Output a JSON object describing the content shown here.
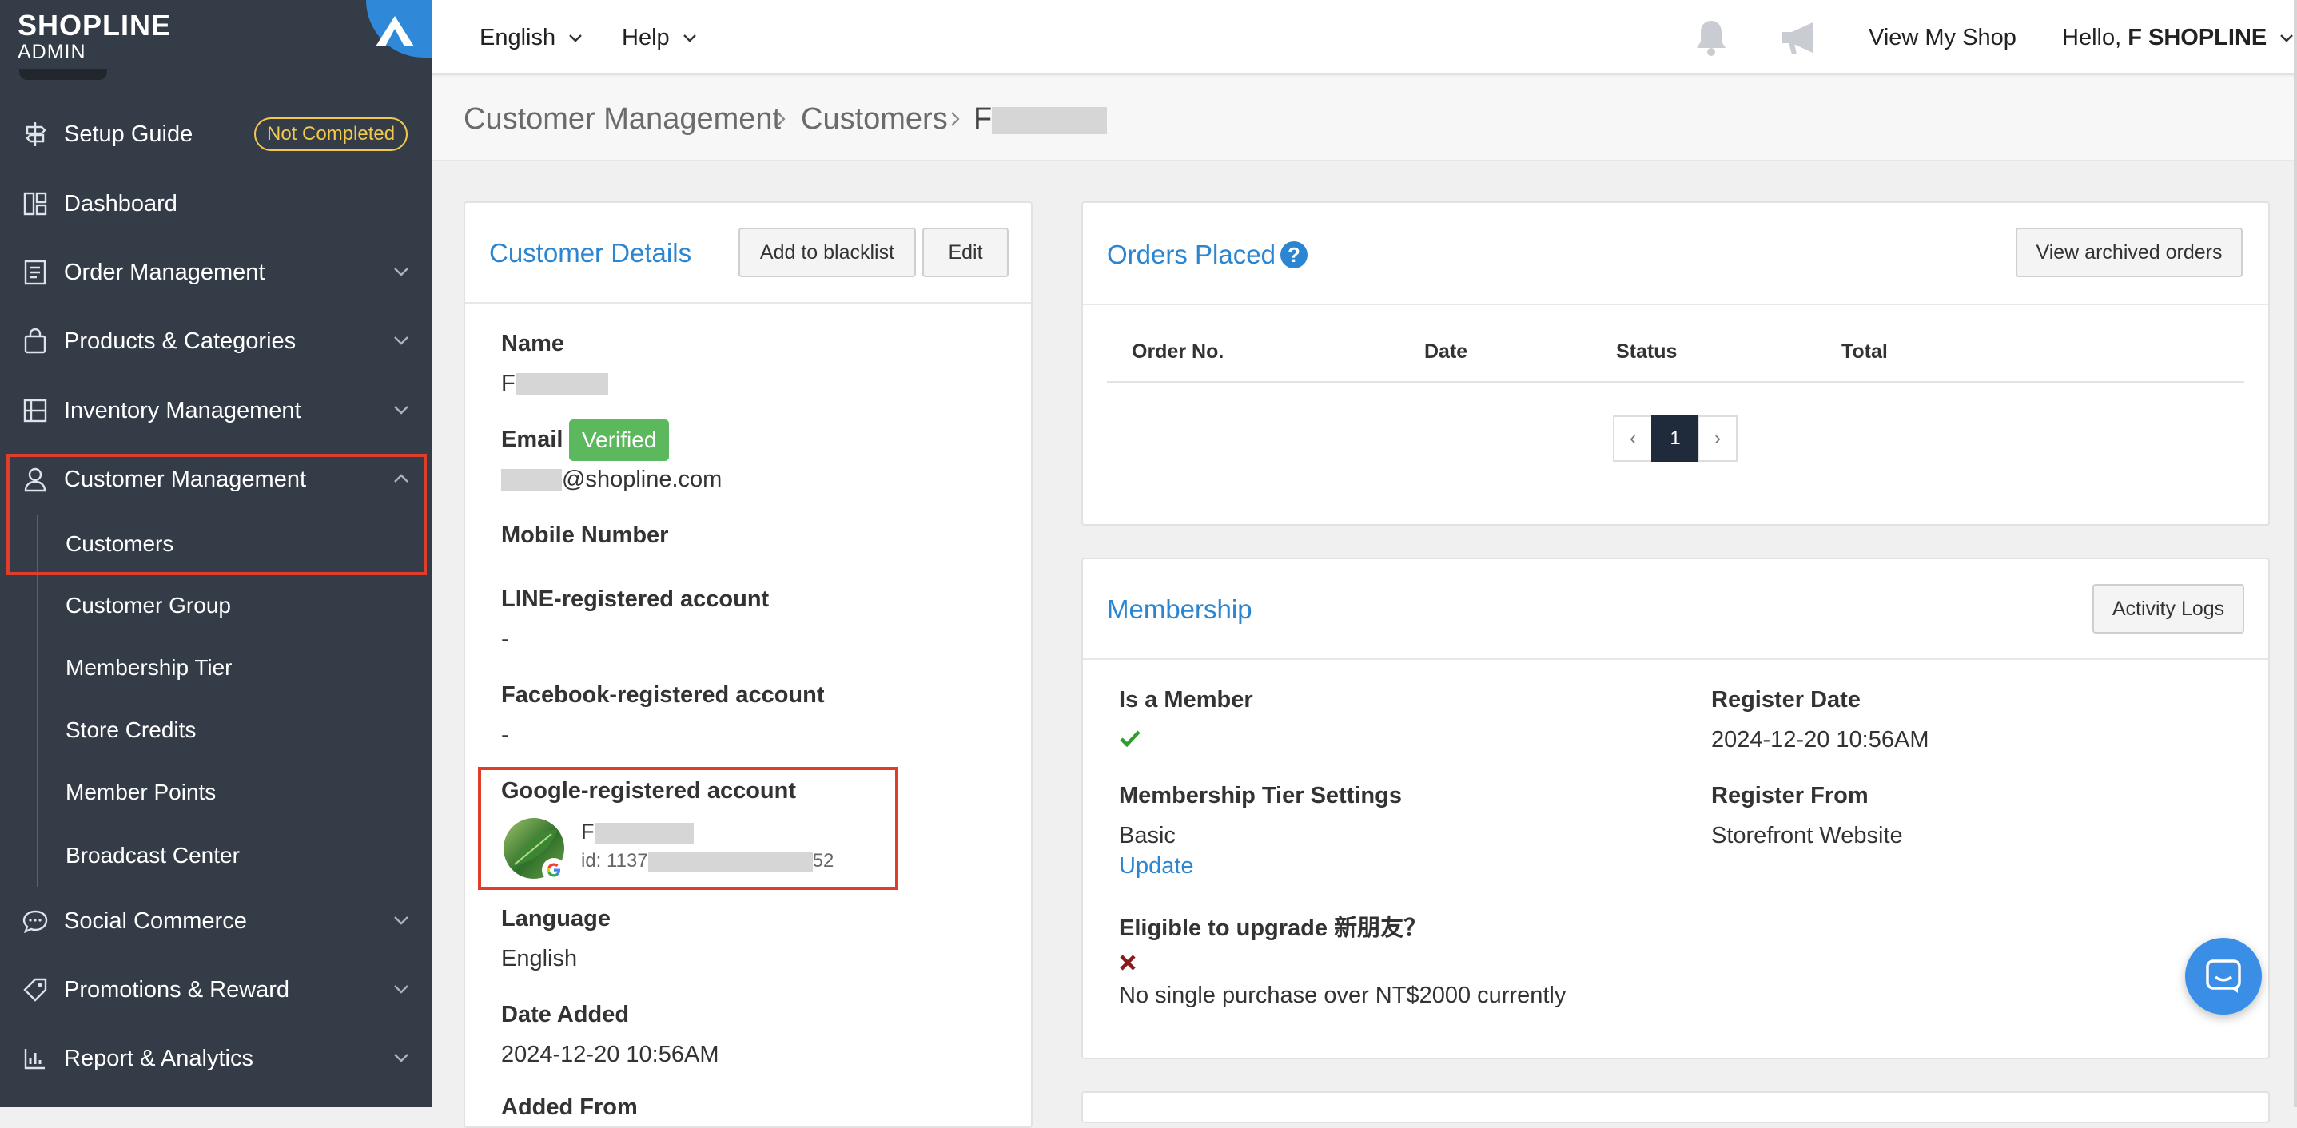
{
  "brand": {
    "name": "SHOPLINE",
    "subtitle": "ADMIN"
  },
  "sidebar": {
    "items": [
      {
        "label": "Setup Guide",
        "badge": "Not Completed",
        "icon": "signpost-icon"
      },
      {
        "label": "Dashboard",
        "icon": "dashboard-icon"
      },
      {
        "label": "Order Management",
        "icon": "clipboard-icon"
      },
      {
        "label": "Products & Categories",
        "icon": "shopping-bag-icon"
      },
      {
        "label": "Inventory Management",
        "icon": "inventory-icon"
      },
      {
        "label": "Customer Management",
        "icon": "user-icon"
      },
      {
        "label": "Social Commerce",
        "icon": "chat-bubble-icon"
      },
      {
        "label": "Promotions & Reward",
        "icon": "tag-icon"
      },
      {
        "label": "Report & Analytics",
        "icon": "bar-chart-icon"
      }
    ],
    "customer_sub": [
      "Customers",
      "Customer Group",
      "Membership Tier",
      "Store Credits",
      "Member Points",
      "Broadcast Center"
    ]
  },
  "topbar": {
    "language": "English",
    "help": "Help",
    "view_shop": "View My Shop",
    "greeting": "Hello,",
    "user": "F SHOPLINE"
  },
  "breadcrumb": [
    "Customer Management",
    "Customers",
    "F"
  ],
  "customer_details": {
    "title": "Customer Details",
    "add_blacklist": "Add to blacklist",
    "edit": "Edit",
    "name_label": "Name",
    "name_value": "F",
    "email_label": "Email",
    "verified": "Verified",
    "email_domain": "@shopline.com",
    "mobile_label": "Mobile Number",
    "line_label": "LINE-registered account",
    "line_value": "-",
    "facebook_label": "Facebook-registered account",
    "facebook_value": "-",
    "google_label": "Google-registered account",
    "google_name": "F",
    "google_id_prefix": "id: 1137",
    "google_id_suffix": "52",
    "language_label": "Language",
    "language_value": "English",
    "date_added_label": "Date Added",
    "date_added_value": "2024-12-20 10:56AM",
    "added_from_label": "Added From"
  },
  "orders": {
    "title": "Orders Placed",
    "view_archived": "View archived orders",
    "columns": [
      "Order No.",
      "Date",
      "Status",
      "Total"
    ],
    "pager": {
      "prev": "‹",
      "current": "1",
      "next": "›"
    }
  },
  "membership": {
    "title": "Membership",
    "activity_logs": "Activity Logs",
    "is_member_label": "Is a Member",
    "register_date_label": "Register Date",
    "register_date_value": "2024-12-20 10:56AM",
    "tier_settings_label": "Membership Tier Settings",
    "tier_value": "Basic",
    "update": "Update",
    "register_from_label": "Register From",
    "register_from_value": "Storefront Website",
    "eligible_label": "Eligible to upgrade 新朋友？",
    "eligible_note": "No single purchase over NT$2000 currently"
  },
  "colors": {
    "accent": "#2b85d0",
    "sidebar": "#343c48",
    "highlight": "#e03e2d",
    "verified": "#5cb85c"
  }
}
